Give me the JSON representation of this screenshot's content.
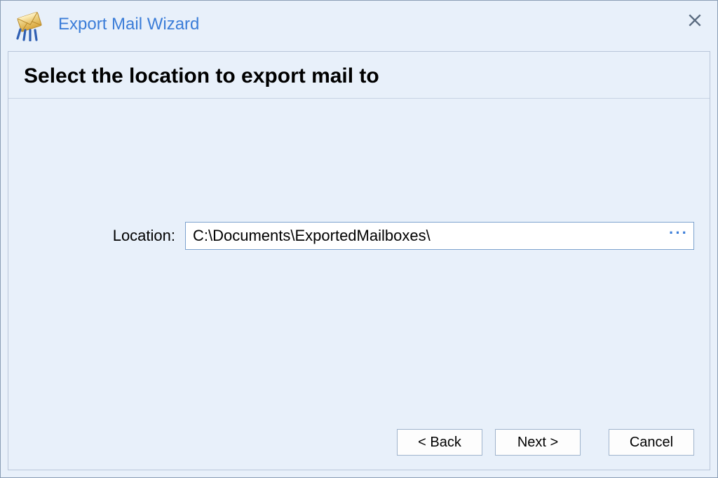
{
  "window": {
    "title": "Export Mail Wizard"
  },
  "page": {
    "heading": "Select the location to export mail to"
  },
  "form": {
    "location_label": "Location:",
    "location_value": "C:\\Documents\\ExportedMailboxes\\",
    "browse_glyph": "···"
  },
  "buttons": {
    "back": "< Back",
    "next": "Next >",
    "cancel": "Cancel"
  }
}
